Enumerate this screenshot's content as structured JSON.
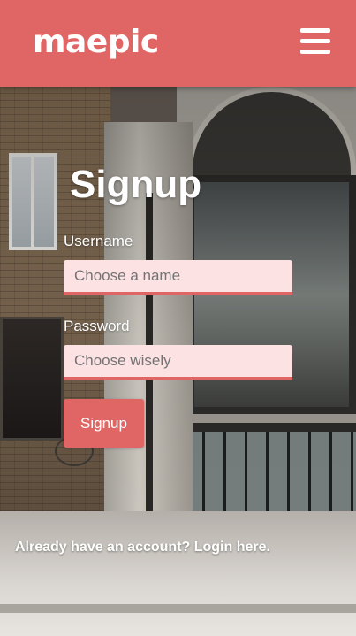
{
  "header": {
    "logo_text": "maepic",
    "menu_icon": "hamburger-menu-icon"
  },
  "form": {
    "title": "Signup",
    "username_label": "Username",
    "username_placeholder": "Choose a name",
    "password_label": "Password",
    "password_placeholder": "Choose wisely",
    "submit_label": "Signup"
  },
  "footer": {
    "login_text": "Already have an account? Login here."
  },
  "colors": {
    "brand": "#e06666",
    "input_background": "#fde2e4",
    "text_on_brand": "#ffffff"
  }
}
